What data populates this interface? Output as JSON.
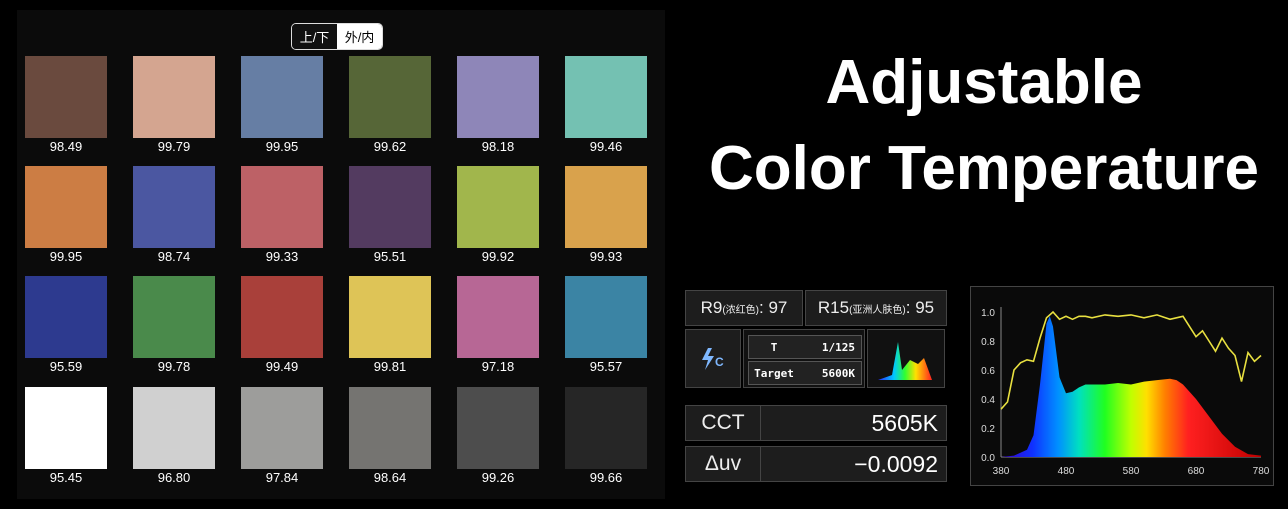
{
  "toggle": {
    "seg1": "上/下",
    "seg2": "外/内"
  },
  "swatches": [
    {
      "color": "#6a4a3e",
      "value": "98.49"
    },
    {
      "color": "#d4a590",
      "value": "99.79"
    },
    {
      "color": "#667ea4",
      "value": "99.95"
    },
    {
      "color": "#566637",
      "value": "99.62"
    },
    {
      "color": "#8e86b8",
      "value": "98.18"
    },
    {
      "color": "#74c1b2",
      "value": "99.46"
    },
    {
      "color": "#cc7d44",
      "value": "99.95"
    },
    {
      "color": "#4b57a1",
      "value": "98.74"
    },
    {
      "color": "#bd6166",
      "value": "99.33"
    },
    {
      "color": "#533b60",
      "value": "95.51"
    },
    {
      "color": "#a1b64c",
      "value": "99.92"
    },
    {
      "color": "#d9a24c",
      "value": "99.93"
    },
    {
      "color": "#2d3a8f",
      "value": "95.59"
    },
    {
      "color": "#4a8a4b",
      "value": "99.78"
    },
    {
      "color": "#a9403a",
      "value": "99.49"
    },
    {
      "color": "#dec457",
      "value": "99.81"
    },
    {
      "color": "#b76795",
      "value": "97.18"
    },
    {
      "color": "#3b84a4",
      "value": "95.57"
    },
    {
      "color": "#ffffff",
      "value": "95.45"
    },
    {
      "color": "#d0d0d0",
      "value": "96.80"
    },
    {
      "color": "#9d9d9b",
      "value": "97.84"
    },
    {
      "color": "#757471",
      "value": "98.64"
    },
    {
      "color": "#4d4d4d",
      "value": "99.26"
    },
    {
      "color": "#262626",
      "value": "99.66"
    }
  ],
  "title": {
    "line1": "Adjustable",
    "line2": "Color Temperature"
  },
  "meter": {
    "r9_label": "R9",
    "r9_sub": "(浓红色)",
    "r9_value": ": 97",
    "r15_label": "R15",
    "r15_sub": "(亚洲人肤色)",
    "r15_value": ": 95",
    "icon": "flash-c-icon",
    "t_label": "T",
    "t_value": "1/125",
    "target_label": "Target",
    "target_value": "5600K",
    "cct_label": "CCT",
    "cct_value": "5605K",
    "duv_label": "Δuv",
    "duv_value": "−0.0092"
  },
  "chart_data": {
    "type": "area",
    "x_ticks": [
      "380",
      "480",
      "580",
      "680",
      "780"
    ],
    "y_ticks": [
      "1.0",
      "0.8",
      "0.6",
      "0.4",
      "0.2",
      "0.0"
    ],
    "xlim": [
      380,
      780
    ],
    "ylim": [
      0,
      1.0
    ],
    "spectrum": {
      "x": [
        380,
        400,
        420,
        430,
        440,
        450,
        455,
        460,
        470,
        480,
        490,
        500,
        510,
        520,
        540,
        560,
        580,
        600,
        620,
        640,
        650,
        660,
        680,
        700,
        720,
        740,
        760,
        780
      ],
      "y": [
        0.0,
        0.01,
        0.05,
        0.15,
        0.5,
        0.92,
        0.97,
        0.9,
        0.55,
        0.44,
        0.45,
        0.48,
        0.5,
        0.5,
        0.5,
        0.51,
        0.5,
        0.52,
        0.53,
        0.54,
        0.53,
        0.5,
        0.4,
        0.28,
        0.16,
        0.07,
        0.02,
        0.01
      ]
    },
    "cri_line": {
      "x": [
        380,
        390,
        400,
        410,
        420,
        430,
        440,
        450,
        460,
        470,
        480,
        490,
        500,
        510,
        520,
        540,
        560,
        580,
        600,
        620,
        640,
        660,
        680,
        690,
        700,
        710,
        720,
        730,
        740,
        750,
        760,
        770,
        780
      ],
      "y": [
        0.33,
        0.38,
        0.6,
        0.65,
        0.67,
        0.66,
        0.82,
        0.96,
        1.0,
        0.95,
        0.97,
        0.95,
        0.97,
        0.97,
        0.96,
        0.98,
        0.97,
        0.98,
        0.96,
        0.98,
        0.95,
        0.97,
        0.83,
        0.87,
        0.8,
        0.73,
        0.82,
        0.75,
        0.7,
        0.52,
        0.72,
        0.66,
        0.7
      ]
    }
  }
}
